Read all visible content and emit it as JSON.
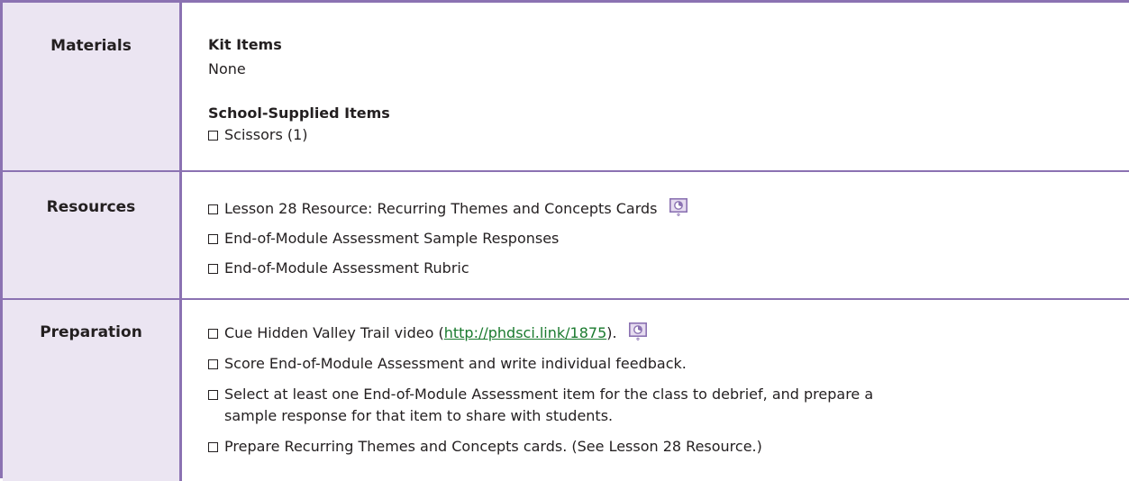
{
  "rows": {
    "materials": {
      "label": "Materials",
      "kit_heading": "Kit Items",
      "kit_value": "None",
      "school_heading": "School-Supplied Items",
      "school_items": [
        "Scissors (1)"
      ]
    },
    "resources": {
      "label": "Resources",
      "items": [
        "Lesson 28 Resource: Recurring Themes and Concepts Cards",
        "End-of-Module Assessment Sample Responses",
        "End-of-Module Assessment Rubric"
      ]
    },
    "preparation": {
      "label": "Preparation",
      "item0_prefix": "Cue Hidden Valley Trail video (",
      "item0_link": "http://phdsci.link/1875",
      "item0_suffix": ").",
      "item1": "Score End-of-Module Assessment and write individual feedback.",
      "item2_line1": "Select at least one End-of-Module Assessment item for the class to debrief, and prepare a",
      "item2_line2": "sample response for that item to share with students.",
      "item3": "Prepare Recurring Themes and Concepts cards. (See Lesson 28 Resource.)"
    }
  },
  "icons": {
    "slide": "slide-timer-icon"
  },
  "colors": {
    "border": "#8b72b2",
    "label_bg": "#ebe5f2",
    "link": "#1a7a2e",
    "icon_fill": "#e6dcf0"
  }
}
